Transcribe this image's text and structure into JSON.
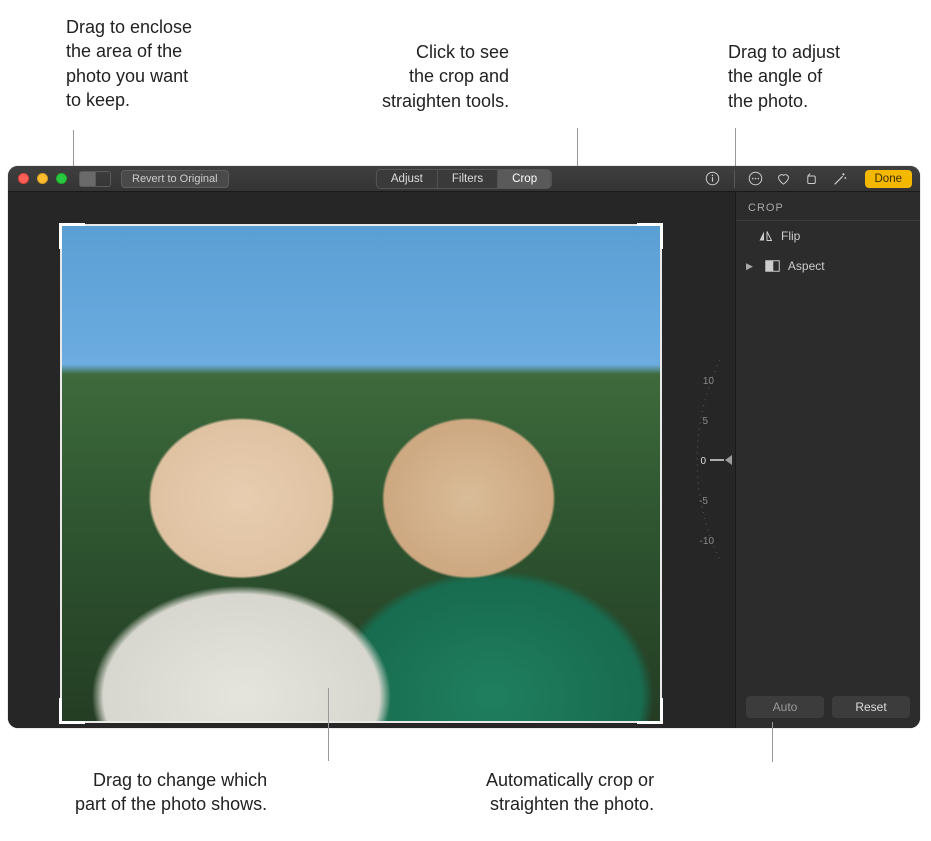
{
  "callouts": {
    "crop_drag": "Drag to enclose\nthe area of the\nphoto you want\nto keep.",
    "crop_tools": "Click to see\nthe crop and\nstraighten tools.",
    "angle_drag": "Drag to adjust\nthe angle of\nthe photo.",
    "photo_drag": "Drag to change which\npart of the photo shows.",
    "auto_crop": "Automatically crop or\nstraighten the photo."
  },
  "toolbar": {
    "revert": "Revert to Original",
    "seg": {
      "adjust": "Adjust",
      "filters": "Filters",
      "crop": "Crop"
    },
    "done": "Done"
  },
  "dial": {
    "ticks": [
      "10",
      "5",
      "0",
      "-5",
      "-10"
    ]
  },
  "sidebar": {
    "title": "CROP",
    "flip": "Flip",
    "aspect": "Aspect"
  },
  "footer": {
    "auto": "Auto",
    "reset": "Reset"
  }
}
